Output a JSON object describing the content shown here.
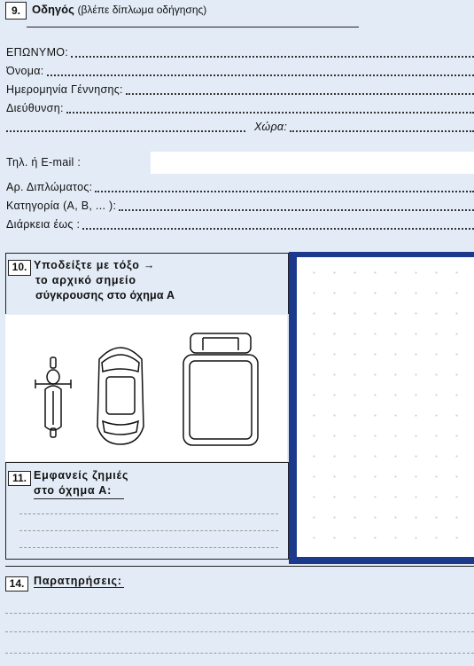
{
  "section9": {
    "number": "9.",
    "title_bold": "Οδηγός",
    "title_rest": "(βλέπε δίπλωμα οδήγησης)",
    "surname": "ΕΠΩΝΥΜΟ:",
    "name": "Όνομα:",
    "dob": "Ημερομηνία Γέννησης:",
    "address": "Διεύθυνση:",
    "country": "Χώρα:",
    "phone": "Τηλ. ή E-mail :",
    "license_no": "Αρ. Διπλώματος:",
    "category": "Κατηγορία (Α, Β, ... ):",
    "valid_until": "Διάρκεια έως :"
  },
  "section10": {
    "number": "10.",
    "line1": "Υποδείξτε με τόξο →",
    "line2": "το αρχικό σημείο",
    "line3": "σύγκρουσης στο όχημα Α"
  },
  "section11": {
    "number": "11.",
    "line1": "Εμφανείς ζημιές",
    "line2": "στο όχημα Α:"
  },
  "section14": {
    "number": "14.",
    "title": "Παρατηρήσεις:"
  },
  "colors": {
    "background": "#e3ecf6",
    "frame": "#1b3a8c",
    "white": "#ffffff"
  }
}
